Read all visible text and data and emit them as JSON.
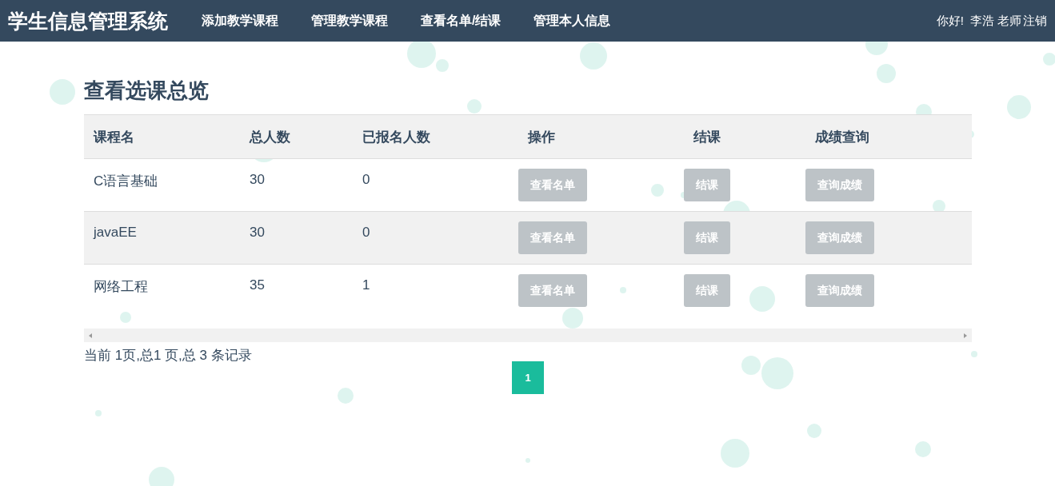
{
  "navbar": {
    "brand": "学生信息管理系统",
    "links": [
      "添加教学课程",
      "管理教学课程",
      "查看名单/结课",
      "管理本人信息"
    ],
    "greeting": "你好!",
    "user": "李浩 老师",
    "logout": "注销"
  },
  "page_title": "查看选课总览",
  "table": {
    "columns": [
      "课程名",
      "总人数",
      "已报名人数",
      "操作",
      "结课",
      "成绩查询"
    ],
    "rows": [
      {
        "course": "C语言基础",
        "total": "30",
        "enrolled": "0",
        "actions": [
          "查看名单",
          "结课",
          "查询成绩"
        ]
      },
      {
        "course": "javaEE",
        "total": "30",
        "enrolled": "0",
        "actions": [
          "查看名单",
          "结课",
          "查询成绩"
        ]
      },
      {
        "course": "网络工程",
        "total": "35",
        "enrolled": "1",
        "actions": [
          "查看名单",
          "结课",
          "查询成绩"
        ]
      }
    ]
  },
  "pagination": {
    "summary": "当前 1页,总1 页,总 3 条记录",
    "pages": [
      {
        "label": "1",
        "selected": true
      }
    ]
  }
}
